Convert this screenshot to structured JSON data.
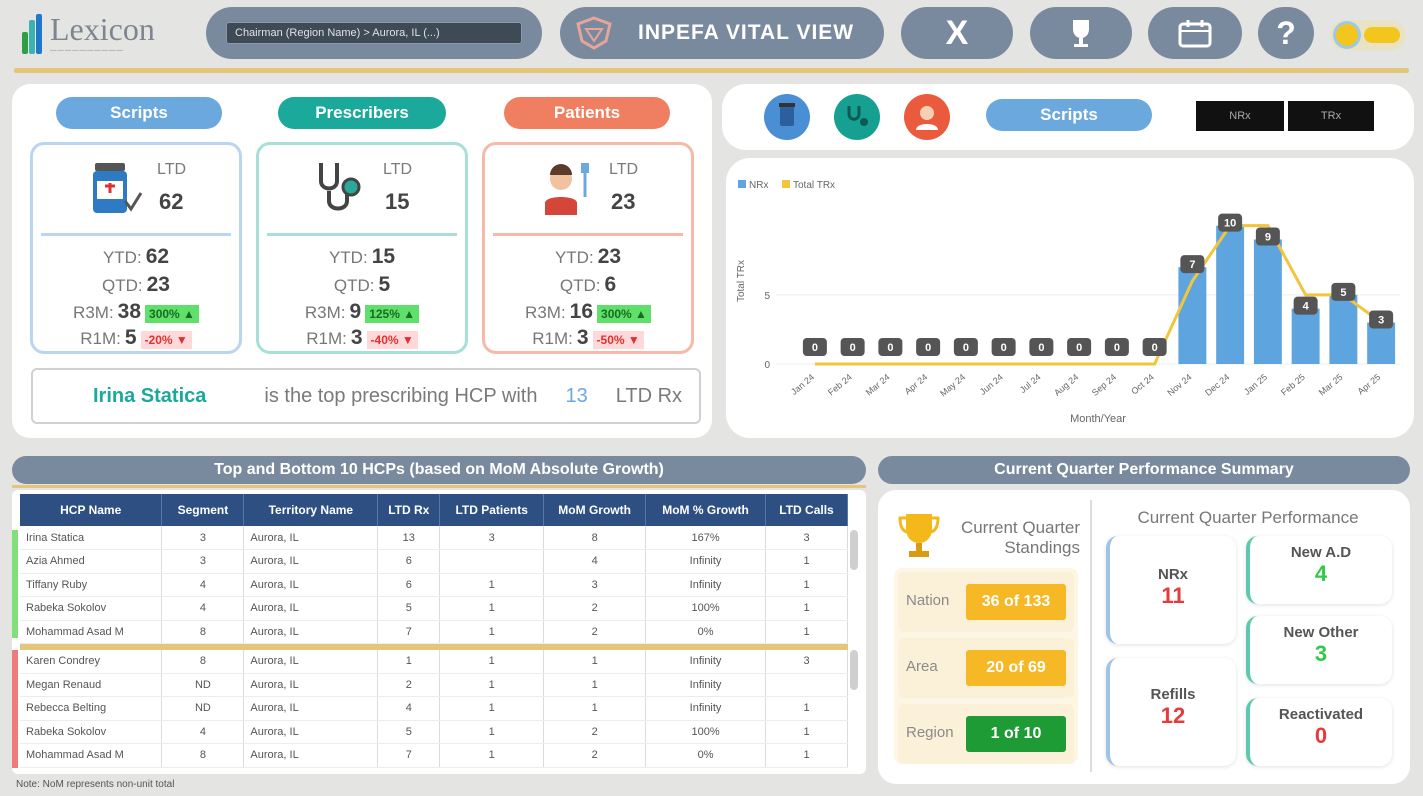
{
  "header": {
    "logo_name": "Lexicon",
    "breadcrumb": "Chairman (Region Name) > Aurora, IL (...)",
    "title": "INPEFA VITAL VIEW",
    "icons": [
      "x-logo-icon",
      "trophy-icon",
      "calendar-icon",
      "help-icon",
      "theme-toggle"
    ]
  },
  "kpis": [
    {
      "label": "Scripts",
      "ltd_label": "LTD",
      "ltd": "62",
      "rows": [
        {
          "label": "YTD:",
          "value": "62"
        },
        {
          "label": "QTD:",
          "value": "23"
        },
        {
          "label": "R3M:",
          "value": "38",
          "change": "300% ▲",
          "dir": "up"
        },
        {
          "label": "R1M:",
          "value": "5",
          "change": "-20% ▼",
          "dir": "down"
        }
      ]
    },
    {
      "label": "Prescribers",
      "ltd_label": "LTD",
      "ltd": "15",
      "rows": [
        {
          "label": "YTD:",
          "value": "15"
        },
        {
          "label": "QTD:",
          "value": "5"
        },
        {
          "label": "R3M:",
          "value": "9",
          "change": "125% ▲",
          "dir": "up"
        },
        {
          "label": "R1M:",
          "value": "3",
          "change": "-40% ▼",
          "dir": "down"
        }
      ]
    },
    {
      "label": "Patients",
      "ltd_label": "LTD",
      "ltd": "23",
      "rows": [
        {
          "label": "YTD:",
          "value": "23"
        },
        {
          "label": "QTD:",
          "value": "6"
        },
        {
          "label": "R3M:",
          "value": "16",
          "change": "300% ▲",
          "dir": "up"
        },
        {
          "label": "R1M:",
          "value": "3",
          "change": "-50% ▼",
          "dir": "down"
        }
      ]
    }
  ],
  "top_hcp": {
    "name": "Irina Statica",
    "text": "is the top prescribing HCP with",
    "count": "13",
    "suffix": "LTD Rx"
  },
  "chart_panel": {
    "metric_pill": "Scripts",
    "toggle_a": "NRx",
    "toggle_b": "TRx"
  },
  "chart_data": {
    "type": "bar",
    "legend": [
      "NRx",
      "Total TRx"
    ],
    "ylabel": "Total TRx",
    "xlabel": "Month/Year",
    "y_ticks": [
      "0",
      "5"
    ],
    "ylim": [
      0,
      12
    ],
    "categories": [
      "Jan 24",
      "Feb 24",
      "Mar 24",
      "Apr 24",
      "May 24",
      "Jun 24",
      "Jul 24",
      "Aug 24",
      "Sep 24",
      "Oct 24",
      "Nov 24",
      "Dec 24",
      "Jan 25",
      "Feb 25",
      "Mar 25",
      "Apr 25"
    ],
    "series": [
      {
        "name": "NRx",
        "values": [
          0,
          0,
          0,
          0,
          0,
          0,
          0,
          0,
          0,
          0,
          7,
          10,
          9,
          4,
          5,
          3
        ],
        "color": "#5ea5e0"
      },
      {
        "name": "Total TRx",
        "values": [
          0,
          0,
          0,
          0,
          0,
          0,
          0,
          0,
          0,
          0,
          6,
          10,
          10,
          5,
          5,
          3
        ],
        "color": "#f3c53d"
      }
    ],
    "data_labels": [
      "0",
      "0",
      "0",
      "0",
      "0",
      "0",
      "0",
      "0",
      "0",
      "0",
      "7",
      "10",
      "9",
      "4",
      "5",
      "3"
    ]
  },
  "table_section": {
    "title": "Top and Bottom 10 HCPs (based on MoM Absolute Growth)",
    "columns": [
      "HCP Name",
      "Segment",
      "Territory Name",
      "LTD Rx",
      "LTD Patients",
      "MoM Growth",
      "MoM % Growth",
      "LTD Calls"
    ],
    "top_rows": [
      [
        "Irina Statica",
        "3",
        "Aurora, IL",
        "13",
        "3",
        "8",
        "167%",
        "3"
      ],
      [
        "Azia Ahmed",
        "3",
        "Aurora, IL",
        "6",
        "",
        "4",
        "Infinity",
        "1"
      ],
      [
        "Tiffany Ruby",
        "4",
        "Aurora, IL",
        "6",
        "1",
        "3",
        "Infinity",
        "1"
      ],
      [
        "Rabeka Sokolov",
        "4",
        "Aurora, IL",
        "5",
        "1",
        "2",
        "100%",
        "1"
      ],
      [
        "Mohammad Asad M",
        "8",
        "Aurora, IL",
        "7",
        "1",
        "2",
        "0%",
        "1"
      ]
    ],
    "bottom_rows": [
      [
        "Karen Condrey",
        "8",
        "Aurora, IL",
        "1",
        "1",
        "1",
        "Infinity",
        "3"
      ],
      [
        "Megan Renaud",
        "ND",
        "Aurora, IL",
        "2",
        "1",
        "1",
        "Infinity",
        ""
      ],
      [
        "Rebecca Belting",
        "ND",
        "Aurora, IL",
        "4",
        "1",
        "1",
        "Infinity",
        "1"
      ],
      [
        "Rabeka Sokolov",
        "4",
        "Aurora, IL",
        "5",
        "1",
        "2",
        "100%",
        "1"
      ],
      [
        "Mohammad Asad M",
        "8",
        "Aurora, IL",
        "7",
        "1",
        "2",
        "0%",
        "1"
      ]
    ],
    "footnote": "Note: NoM represents non-unit total"
  },
  "perf_section": {
    "title": "Current Quarter Performance Summary",
    "standings_title": "Current Quarter Standings",
    "standings": [
      {
        "label": "Nation",
        "value": "36 of 133",
        "color": "#f7b826"
      },
      {
        "label": "Area",
        "value": "20 of 69",
        "color": "#f7b826"
      },
      {
        "label": "Region",
        "value": "1 of 10",
        "color": "#1f9b35"
      }
    ],
    "performance_title": "Current Quarter Performance",
    "metrics_left": [
      {
        "label": "NRx",
        "value": "11",
        "color": "#e83a3a"
      },
      {
        "label": "Refills",
        "value": "12",
        "color": "#e83a3a"
      }
    ],
    "metrics_right": [
      {
        "label": "New A.D",
        "value": "4",
        "color": "#32c94a"
      },
      {
        "label": "New Other",
        "value": "3",
        "color": "#32c94a"
      },
      {
        "label": "Reactivated",
        "value": "0",
        "color": "#e83a3a"
      }
    ]
  }
}
